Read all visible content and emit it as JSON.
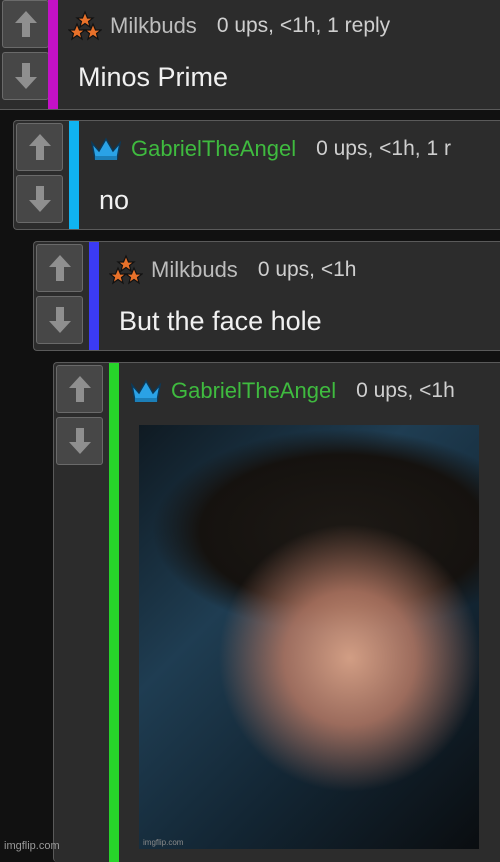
{
  "comments": [
    {
      "username": "Milkbuds",
      "stats": "0 ups, <1h, 1 reply",
      "text": "Minos Prime",
      "bar_color": "#c311c6",
      "avatar": "three-stars-icon",
      "username_color": "#bdbdbd"
    },
    {
      "username": "GabrielTheAngel",
      "stats": "0 ups, <1h, 1 r",
      "text": "no",
      "bar_color": "#10b3f0",
      "avatar": "crown-icon",
      "username_color": "#3fbb3f"
    },
    {
      "username": "Milkbuds",
      "stats": "0 ups, <1h",
      "text": "But the face hole",
      "bar_color": "#3b3bf5",
      "avatar": "three-stars-icon",
      "username_color": "#bdbdbd"
    },
    {
      "username": "GabrielTheAngel",
      "stats": "0 ups, <1h",
      "image_caption": "imgflip.com",
      "bar_color": "#27d52a",
      "avatar": "crown-icon",
      "username_color": "#3fbb3f"
    }
  ],
  "watermark": "imgflip.com"
}
